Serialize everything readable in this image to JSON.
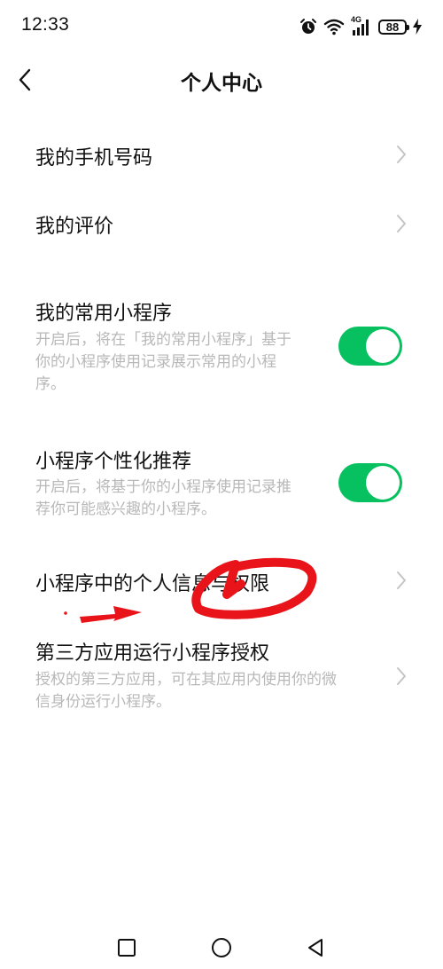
{
  "status_bar": {
    "time": "12:33",
    "network": "4G",
    "battery": "88",
    "icons": [
      "alarm-icon",
      "wifi-icon",
      "signal-icon",
      "battery-icon",
      "charging-icon"
    ]
  },
  "header": {
    "title": "个人中心",
    "back_icon": "chevron-left-icon"
  },
  "items": [
    {
      "title": "我的手机号码",
      "control": "chevron"
    },
    {
      "title": "我的评价",
      "control": "chevron"
    },
    {
      "title": "我的常用小程序",
      "description": "开启后，将在「我的常用小程序」基于你的小程序使用记录展示常用的小程序。",
      "control": "toggle",
      "enabled": true
    },
    {
      "title": "小程序个性化推荐",
      "description": "开启后，将基于你的小程序使用记录推荐你可能感兴趣的小程序。",
      "control": "toggle",
      "enabled": true
    },
    {
      "title": "小程序中的个人信息与权限",
      "control": "chevron"
    },
    {
      "title": "第三方应用运行小程序授权",
      "description": "授权的第三方应用，可在其应用内使用你的微信身份运行小程序。",
      "control": "chevron"
    }
  ],
  "colors": {
    "toggle_on": "#07c160",
    "annotation": "#e8141a",
    "description_text": "#b8b8b8"
  },
  "nav_bar": {
    "icons": [
      "square-recent-icon",
      "circle-home-icon",
      "triangle-back-icon"
    ]
  }
}
